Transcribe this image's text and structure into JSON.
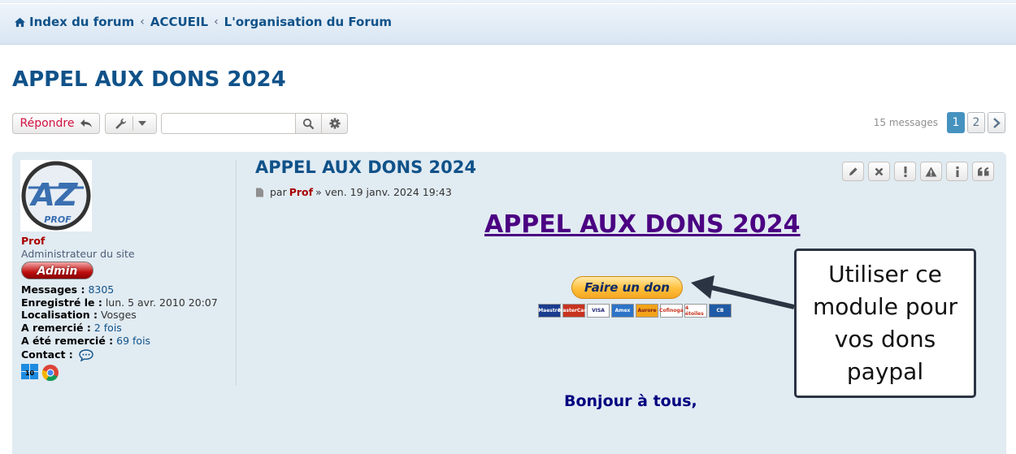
{
  "breadcrumb": {
    "items": [
      "Index du forum",
      "ACCUEIL",
      "L'organisation du Forum"
    ]
  },
  "page": {
    "title": "APPEL AUX DONS 2024"
  },
  "actions": {
    "reply_label": "Répondre",
    "search_placeholder": ""
  },
  "pagination": {
    "count": "15 messages",
    "pages": [
      "1",
      "2"
    ],
    "current": "1"
  },
  "post": {
    "title": "APPEL AUX DONS 2024",
    "meta_prefix": "par",
    "author": "Prof",
    "meta_date": "» ven. 19 janv. 2024 19:43",
    "content_title": "APPEL AUX DONS 2024",
    "donate_label": "Faire un don",
    "greeting": "Bonjour à tous,"
  },
  "profile": {
    "username": "Prof",
    "rank": "Administrateur du site",
    "rank_badge": "Admin",
    "fields": [
      {
        "label": "Messages :",
        "value": "8305",
        "link": true
      },
      {
        "label": "Enregistré le :",
        "value": "lun. 5 avr. 2010 20:07",
        "link": false
      },
      {
        "label": "Localisation :",
        "value": "Vosges",
        "link": false
      },
      {
        "label": "A remercié :",
        "value": "2 fois",
        "link": true
      },
      {
        "label": "A été remercié :",
        "value": "69 fois",
        "link": true
      }
    ],
    "contact_label": "Contact :"
  },
  "card_logos": [
    "Maestro",
    "MasterCard",
    "VISA",
    "Amex",
    "Aurore",
    "Cofinoga",
    "4 étoiles",
    "CB"
  ],
  "callout": {
    "text": "Utiliser ce module pour vos dons paypal"
  },
  "colors": {
    "link": "#105289",
    "author": "#aa0000",
    "post_bg": "#e1ebf2",
    "content_title": "#4b0082"
  }
}
